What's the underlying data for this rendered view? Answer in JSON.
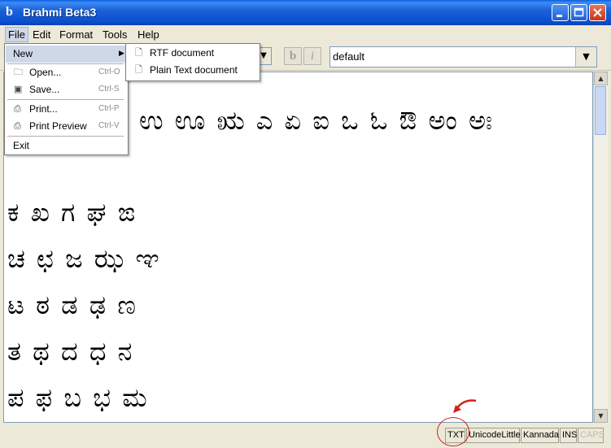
{
  "window": {
    "title": "Brahmi Beta3",
    "app_icon_glyph": "b"
  },
  "menubar": [
    "File",
    "Edit",
    "Format",
    "Tools",
    "Help"
  ],
  "toolbar": {
    "bold_label": "b",
    "italic_label": "i",
    "style_combo_value": "default"
  },
  "editor": {
    "lines": [
      "ಉ ಊ ಋ ಎ ಏ ಐ ಒ ಓ ಔ ಅಂ ಅಃ",
      "ಕ ಖ ಗ ಘ ಙ",
      "ಚ ಛ ಜ ಝ ಞ",
      "ಟ ಠ ಡ ಢ ಣ",
      "ತ ಥ ದ ಧ ನ",
      "ಪ ಫ ಬ ಭ ಮ"
    ]
  },
  "file_menu": {
    "items": [
      {
        "label": "New",
        "accel": "",
        "icon": "",
        "submenu": true
      },
      {
        "label": "Open...",
        "accel": "Ctrl-O",
        "icon": "folder-icon"
      },
      {
        "label": "Save...",
        "accel": "Ctrl-S",
        "icon": "floppy-icon"
      },
      {
        "label": "Print...",
        "accel": "Ctrl-P",
        "icon": "printer-icon"
      },
      {
        "label": "Print Preview",
        "accel": "Ctrl-V",
        "icon": "preview-icon"
      },
      {
        "label": "Exit",
        "accel": "",
        "icon": ""
      }
    ]
  },
  "new_submenu": {
    "items": [
      "RTF document",
      "Plain Text document"
    ]
  },
  "statusbar": {
    "format": "TXT",
    "encoding": "UnicodeLittle",
    "language": "Kannada",
    "mode": "INS",
    "caps": "CAPS"
  },
  "colors": {
    "titlebar": "#0a4fcf",
    "annotation": "#d4201a",
    "menu_highlight": "#cfd8e9"
  }
}
